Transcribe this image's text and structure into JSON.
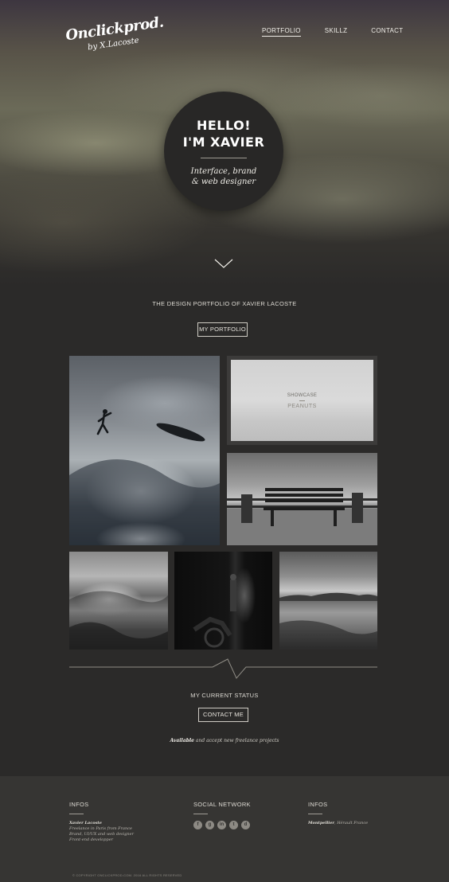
{
  "header": {
    "logo_main": "Onclickprod.",
    "logo_sub": "by X.Lacoste",
    "nav": [
      "PORTFOLIO",
      "SKILLZ",
      "CONTACT"
    ]
  },
  "hero": {
    "greeting_line1": "HELLO!",
    "greeting_line2": "I'M XAVIER",
    "tagline_line1": "Interface, brand",
    "tagline_line2": "& web designer"
  },
  "intro": {
    "text": "THE DESIGN PORTFOLIO OF XAVIER LACOSTE",
    "button": "MY PORTFOLIO"
  },
  "portfolio": {
    "featured_overlay_label": "SHOWCASE",
    "featured_overlay_title": "PEANUTS"
  },
  "status": {
    "title": "MY CURRENT STATUS",
    "button": "CONTACT ME",
    "availability_bold": "Available",
    "availability_rest": " and accept new freelance projects"
  },
  "footer": {
    "col1_title": "INFOS",
    "col1_name": "Xavier Lacoste",
    "col1_lines": [
      "Freelance in Paris from France",
      "Brand, UI/UX and web designer",
      "Front-end developper"
    ],
    "col2_title": "SOCIAL NETWORK",
    "social_icons": [
      "facebook-icon",
      "google-plus-icon",
      "linkedin-icon",
      "twitter-icon",
      "dribbble-icon"
    ],
    "social_glyphs": [
      "f",
      "g",
      "in",
      "t",
      "d"
    ],
    "col3_title": "INFOS",
    "col3_city": "Montpellier",
    "col3_region": ", Hérault France",
    "copyright": "© COPYRIGHT ONCLICKPROD.COM. 2016 ALL RIGHTS RESERVED"
  },
  "colors": {
    "background": "#2b2a29",
    "footer_bg": "#363533",
    "circle_bg": "#282726",
    "text": "#e6e3dc"
  }
}
